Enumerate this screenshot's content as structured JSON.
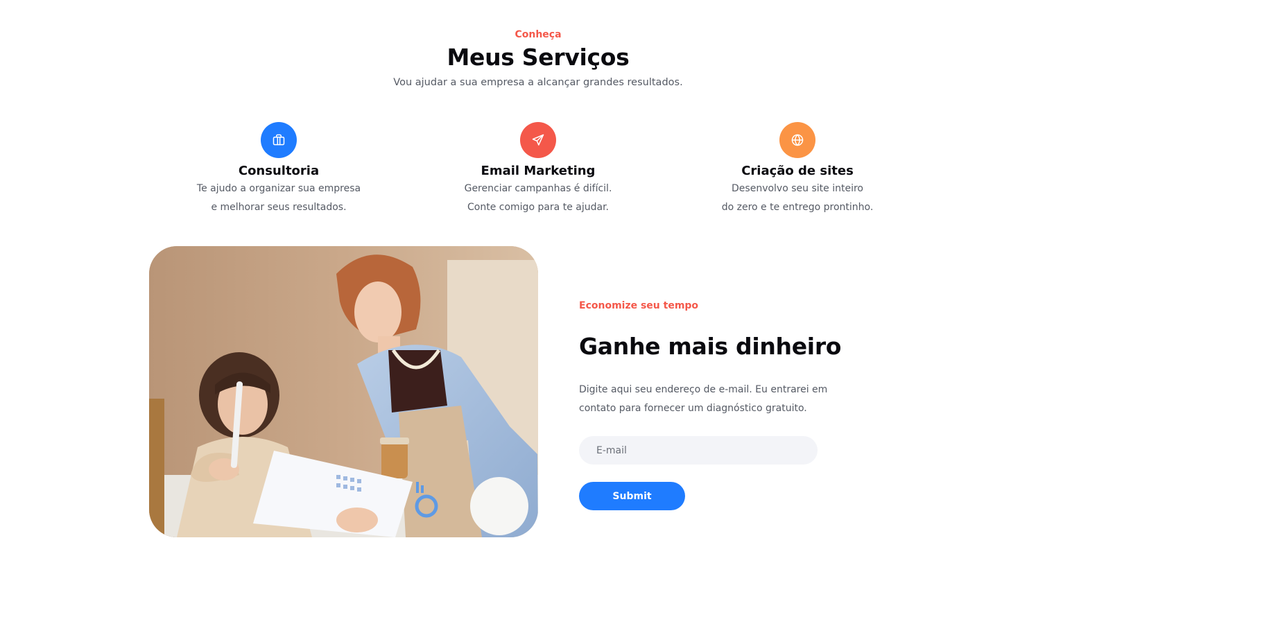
{
  "services_section": {
    "eyebrow": "Conheça",
    "title": "Meus Serviços",
    "subtitle": "Vou ajudar a sua empresa a alcançar grandes resultados.",
    "items": [
      {
        "icon": "briefcase-icon",
        "icon_color": "#1f7cff",
        "title": "Consultoria",
        "line1": "Te ajudo a organizar sua empresa",
        "line2": "e melhorar seus resultados."
      },
      {
        "icon": "paper-plane-icon",
        "icon_color": "#f4584a",
        "title": "Email Marketing",
        "line1": "Gerenciar campanhas é difícil.",
        "line2": "Conte comigo para te ajudar."
      },
      {
        "icon": "globe-icon",
        "icon_color": "#fb9445",
        "title": "Criação de sites",
        "line1": "Desenvolvo seu site inteiro",
        "line2": "do zero e te entrego prontinho."
      }
    ]
  },
  "cta_section": {
    "eyebrow": "Economize seu tempo",
    "title": "Ganhe mais dinheiro",
    "text_line1": "Digite aqui seu endereço de e-mail. Eu entrarei em",
    "text_line2": "contato para fornecer um diagnóstico gratuito.",
    "email_placeholder": "E-mail",
    "submit_label": "Submit"
  },
  "colors": {
    "accent_red": "#f4584a",
    "accent_blue": "#1f7cff",
    "accent_orange": "#fb9445",
    "field_bg": "#f3f4f8"
  }
}
